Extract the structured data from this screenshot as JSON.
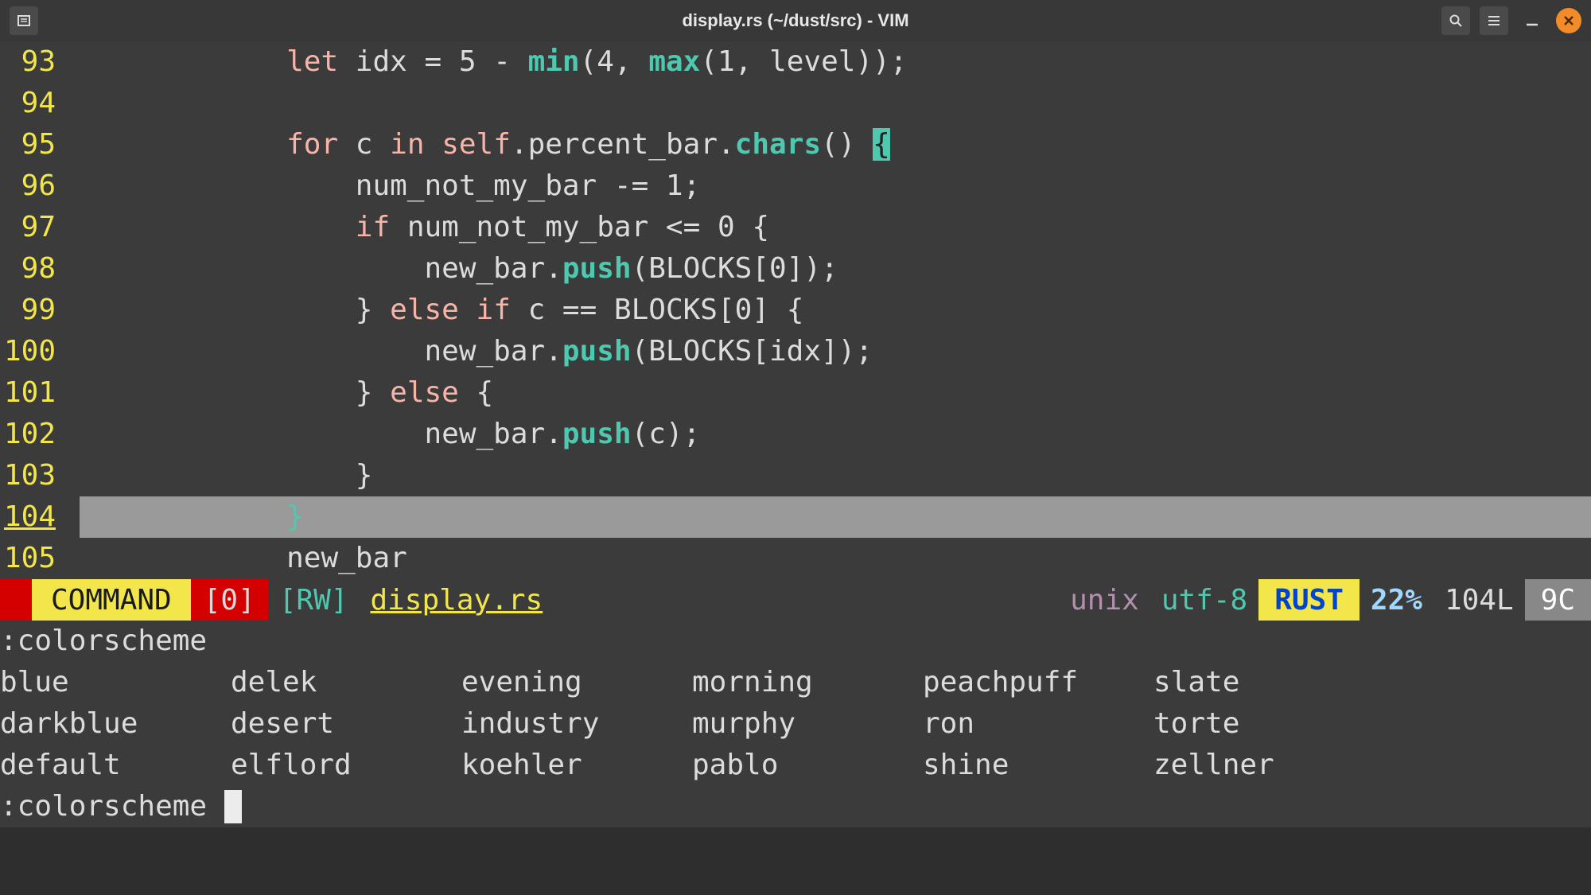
{
  "window": {
    "title": "display.rs (~/dust/src) - VIM"
  },
  "code": {
    "lines": [
      {
        "num": "93",
        "indent": "            ",
        "tokens": [
          [
            "kw-let",
            "let"
          ],
          [
            "",
            " idx = "
          ],
          [
            "num",
            "5"
          ],
          [
            "",
            " - "
          ],
          [
            "fn-call",
            "min"
          ],
          [
            "",
            "("
          ],
          [
            "num",
            "4"
          ],
          [
            "",
            ", "
          ],
          [
            "fn-call",
            "max"
          ],
          [
            "",
            "("
          ],
          [
            "num",
            "1"
          ],
          [
            "",
            ", level));"
          ]
        ]
      },
      {
        "num": "94",
        "indent": "",
        "tokens": []
      },
      {
        "num": "95",
        "indent": "            ",
        "tokens": [
          [
            "kw-for",
            "for"
          ],
          [
            "",
            " c "
          ],
          [
            "kw-in",
            "in"
          ],
          [
            "",
            " "
          ],
          [
            "kw-self",
            "self"
          ],
          [
            "",
            ".percent_bar."
          ],
          [
            "fn-call",
            "chars"
          ],
          [
            "",
            "() "
          ],
          [
            "hl-brace",
            "{"
          ]
        ]
      },
      {
        "num": "96",
        "indent": "                ",
        "tokens": [
          [
            "",
            "num_not_my_bar -= "
          ],
          [
            "num",
            "1"
          ],
          [
            "",
            ";"
          ]
        ]
      },
      {
        "num": "97",
        "indent": "                ",
        "tokens": [
          [
            "kw-if",
            "if"
          ],
          [
            "",
            " num_not_my_bar <= "
          ],
          [
            "num",
            "0"
          ],
          [
            "",
            " {"
          ]
        ]
      },
      {
        "num": "98",
        "indent": "                    ",
        "tokens": [
          [
            "",
            "new_bar."
          ],
          [
            "fn-call",
            "push"
          ],
          [
            "",
            "(BLOCKS["
          ],
          [
            "num",
            "0"
          ],
          [
            "",
            "]);"
          ]
        ]
      },
      {
        "num": "99",
        "indent": "                ",
        "tokens": [
          [
            "",
            "} "
          ],
          [
            "kw-else",
            "else"
          ],
          [
            "",
            " "
          ],
          [
            "kw-if",
            "if"
          ],
          [
            "",
            " c == BLOCKS["
          ],
          [
            "num",
            "0"
          ],
          [
            "",
            "] {"
          ]
        ]
      },
      {
        "num": "100",
        "indent": "                    ",
        "tokens": [
          [
            "",
            "new_bar."
          ],
          [
            "fn-call",
            "push"
          ],
          [
            "",
            "(BLOCKS[idx]);"
          ]
        ]
      },
      {
        "num": "101",
        "indent": "                ",
        "tokens": [
          [
            "",
            "} "
          ],
          [
            "kw-else",
            "else"
          ],
          [
            "",
            " {"
          ]
        ]
      },
      {
        "num": "102",
        "indent": "                    ",
        "tokens": [
          [
            "",
            "new_bar."
          ],
          [
            "fn-call",
            "push"
          ],
          [
            "",
            "(c);"
          ]
        ]
      },
      {
        "num": "103",
        "indent": "                ",
        "tokens": [
          [
            "",
            "}"
          ]
        ]
      },
      {
        "num": "104",
        "indent": "            ",
        "tokens": [
          [
            "",
            "}"
          ]
        ],
        "cursor": true
      },
      {
        "num": "105",
        "indent": "            ",
        "tokens": [
          [
            "",
            "new_bar"
          ]
        ]
      }
    ]
  },
  "statusline": {
    "mode": " COMMAND ",
    "bufnum": "[0]",
    "rw": "[RW]",
    "filename": "display.rs",
    "format": "unix",
    "encoding": "utf-8",
    "filetype": "RUST",
    "percent": "22%",
    "lines": "104L",
    "col": "9C"
  },
  "command": {
    "header": ":colorscheme",
    "completions": [
      [
        "blue",
        "delek",
        "evening",
        "morning",
        "peachpuff",
        "slate"
      ],
      [
        "darkblue",
        "desert",
        "industry",
        "murphy",
        "ron",
        "torte"
      ],
      [
        "default",
        "elflord",
        "koehler",
        "pablo",
        "shine",
        "zellner"
      ]
    ],
    "input": ":colorscheme"
  }
}
